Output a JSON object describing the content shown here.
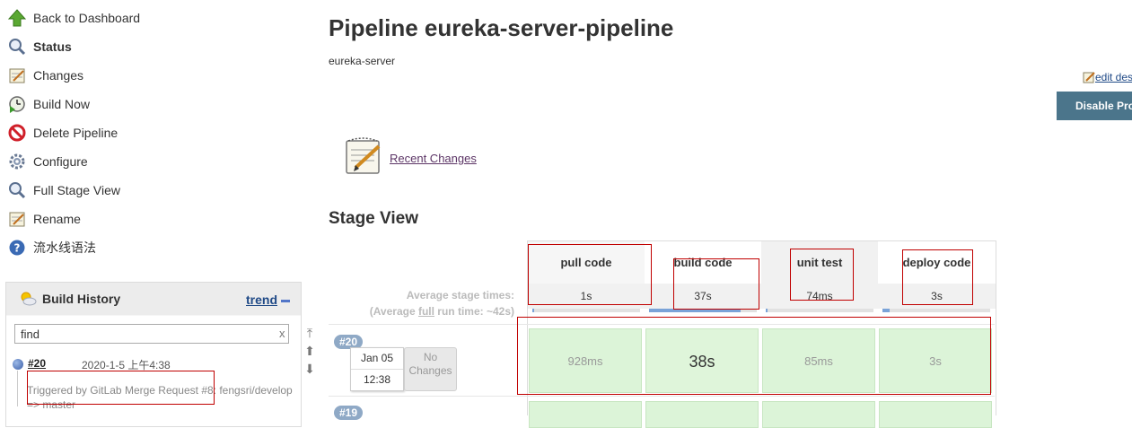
{
  "sidebar": {
    "items": [
      {
        "label": "Back to Dashboard",
        "icon": "up-arrow-icon"
      },
      {
        "label": "Status",
        "icon": "magnifier-icon"
      },
      {
        "label": "Changes",
        "icon": "notepad-icon"
      },
      {
        "label": "Build Now",
        "icon": "clock-play-icon"
      },
      {
        "label": "Delete Pipeline",
        "icon": "no-entry-icon"
      },
      {
        "label": "Configure",
        "icon": "gear-icon"
      },
      {
        "label": "Full Stage View",
        "icon": "magnifier-icon"
      },
      {
        "label": "Rename",
        "icon": "notepad-icon"
      },
      {
        "label": "流水线语法",
        "icon": "help-icon"
      }
    ]
  },
  "build_history": {
    "title": "Build History",
    "trend": "trend",
    "search_value": "find",
    "clear": "x",
    "builds": [
      {
        "number": "#20",
        "date": "2020-1-5 上午4:38",
        "description": "Triggered by GitLab Merge Request #8: fengsri/develop => master"
      }
    ]
  },
  "main": {
    "title": "Pipeline eureka-server-pipeline",
    "subtitle": "eureka-server",
    "edit_description": "edit description",
    "disable_button": "Disable Project",
    "recent_changes": "Recent Changes"
  },
  "stage_view": {
    "title": "Stage View",
    "avg_label_line1": "Average stage times:",
    "avg_label_line2_pre": "(Average ",
    "avg_label_line2_link": "full",
    "avg_label_line2_post": " run time: ~42s)",
    "stages": [
      {
        "name": "pull code",
        "avg": "1s",
        "bar_fraction": 0.01
      },
      {
        "name": "build code",
        "avg": "37s",
        "bar_fraction": 0.85
      },
      {
        "name": "unit test",
        "avg": "74ms",
        "bar_fraction": 0.02
      },
      {
        "name": "deploy code",
        "avg": "3s",
        "bar_fraction": 0.07
      }
    ],
    "runs": [
      {
        "badge": "#20",
        "date": "Jan 05",
        "time": "12:38",
        "changes": "No Changes",
        "durations": [
          "928ms",
          "38s",
          "85ms",
          "3s"
        ]
      },
      {
        "badge": "#19"
      }
    ]
  }
}
